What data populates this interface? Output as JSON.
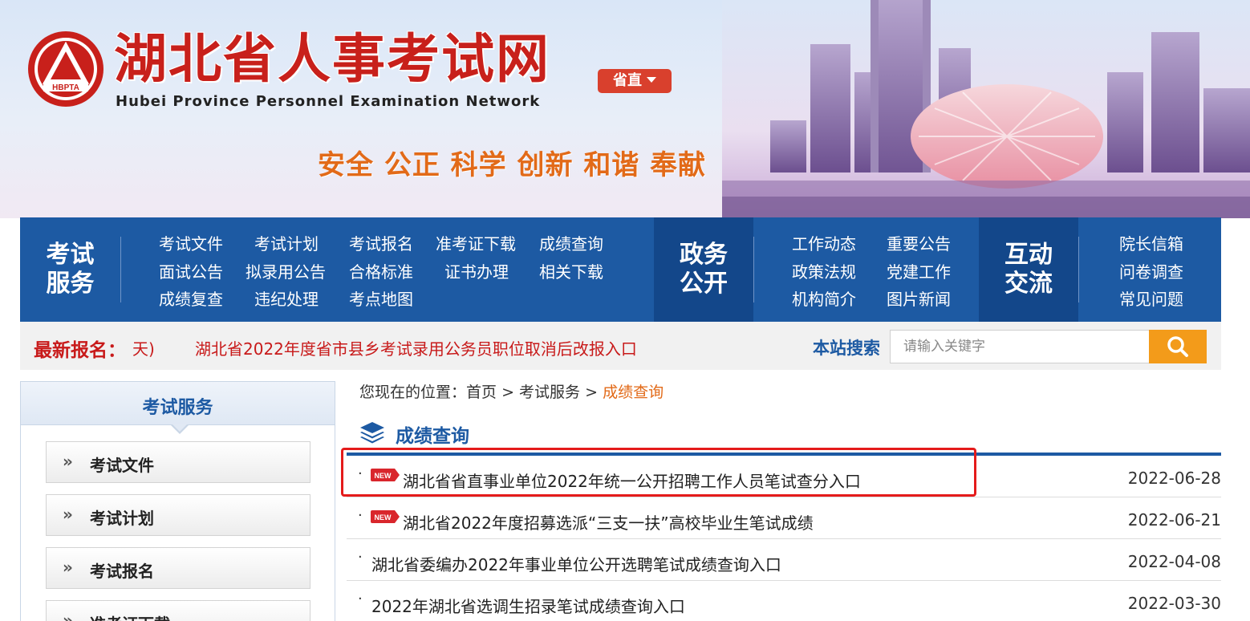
{
  "header": {
    "site_title": "湖北省人事考试网",
    "site_subtitle": "Hubei Province Personnel Examination Network",
    "logo_text": "HBPTA",
    "region_selector": "省直",
    "slogan": "安全 公正 科学 创新 和谐 奉献"
  },
  "nav": {
    "categories": [
      "考试服务",
      "政务公开",
      "互动交流"
    ],
    "category_lines": [
      [
        "考试",
        "服务"
      ],
      [
        "政务",
        "公开"
      ],
      [
        "互动",
        "交流"
      ]
    ],
    "exam_links": [
      "考试文件",
      "考试计划",
      "考试报名",
      "准考证下载",
      "成绩查询",
      "面试公告",
      "拟录用公告",
      "合格标准",
      "证书办理",
      "相关下载",
      "成绩复查",
      "违纪处理",
      "考点地图"
    ],
    "gov_links": [
      "工作动态",
      "重要公告",
      "政策法规",
      "党建工作",
      "机构简介",
      "图片新闻"
    ],
    "interact_links": [
      "院长信箱",
      "问卷调查",
      "常见问题"
    ]
  },
  "ticker": {
    "label": "最新报名：",
    "fragment": "天)",
    "text": "湖北省2022年度省市县乡考试录用公务员职位取消后改报入口"
  },
  "search": {
    "label": "本站搜索",
    "placeholder": "请输入关键字"
  },
  "sidebar": {
    "title": "考试服务",
    "items": [
      "考试文件",
      "考试计划",
      "考试报名",
      "准考证下载"
    ]
  },
  "breadcrumb": {
    "prefix": "您现在的位置：",
    "items": [
      "首页",
      "考试服务",
      "成绩查询"
    ],
    "separator": ">"
  },
  "section": {
    "title": "成绩查询",
    "new_badge": "NEW",
    "list": [
      {
        "title": "湖北省省直事业单位2022年统一公开招聘工作人员笔试查分入口",
        "date": "2022-06-28",
        "is_new": true
      },
      {
        "title": "湖北省2022年度招募选派“三支一扶”高校毕业生笔试成绩",
        "date": "2022-06-21",
        "is_new": true
      },
      {
        "title": "湖北省委编办2022年事业单位公开选聘笔试成绩查询入口",
        "date": "2022-04-08",
        "is_new": false
      },
      {
        "title": "2022年湖北省选调生招录笔试成绩查询入口",
        "date": "2022-03-30",
        "is_new": false
      }
    ]
  },
  "colors": {
    "brand_red": "#c8201b",
    "nav_blue": "#1d5aa3",
    "accent_orange": "#f39b1a",
    "highlight_red": "#e41b1b"
  }
}
